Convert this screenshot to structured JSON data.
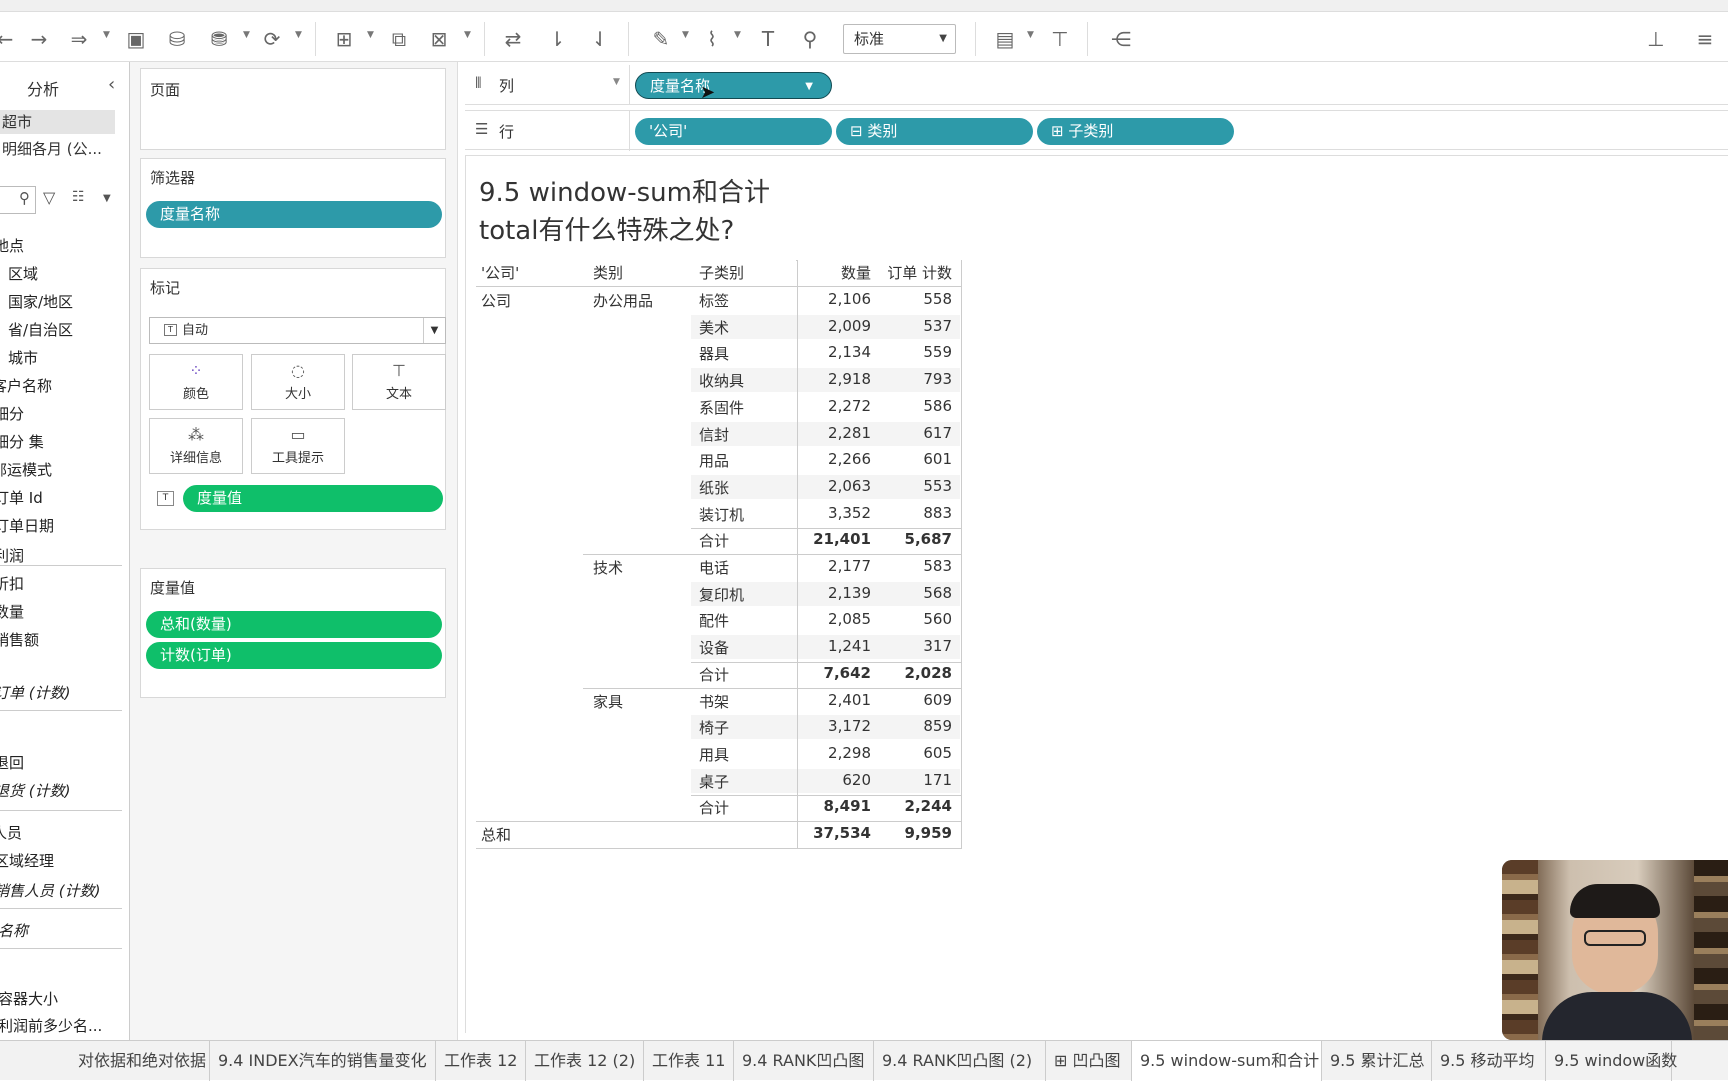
{
  "toolbar": {
    "standard_select": "标准"
  },
  "left_pane": {
    "tab_label": "分析",
    "datasources": [
      "超市",
      "明细各月 (公..."
    ],
    "fields_dimensions": [
      "地点",
      "区域",
      "国家/地区",
      "省/自治区",
      "城市",
      "客户名称",
      "细分",
      "细分 集",
      "邮运模式",
      "订单 Id",
      "订单日期"
    ],
    "fields_measures": [
      "利润",
      "折扣",
      "数量",
      "销售额",
      "订单 (计数)"
    ],
    "fields_return": [
      "退回",
      "退货 (计数)"
    ],
    "fields_people": [
      "人员",
      "区域经理",
      "销售人员 (计数)"
    ],
    "fields_names": [
      "名称"
    ],
    "fields_sets": [
      "容器大小",
      "利润前多少名..."
    ]
  },
  "cards": {
    "pages": "页面",
    "filters": "筛选器",
    "filter_pill": "度量名称",
    "marks": "标记",
    "mark_type": "自动",
    "mark_buttons": [
      "颜色",
      "大小",
      "文本",
      "详细信息",
      "工具提示"
    ],
    "mark_pill": "度量值",
    "measure_values": "度量值",
    "measure_pills": [
      "总和(数量)",
      "计数(订单)"
    ]
  },
  "shelves": {
    "columns_label": "列",
    "columns_pill": "度量名称",
    "rows_label": "行",
    "rows_pills": [
      "'公司'",
      "⊟ 类别",
      "⊞ 子类别"
    ]
  },
  "view": {
    "title_line1": "9.5 window-sum和合计",
    "title_line2": "total有什么特殊之处?",
    "headers": [
      "'公司'",
      "类别",
      "子类别",
      "数量",
      "订单 计数"
    ],
    "company": "公司",
    "groups": [
      {
        "category": "办公用品",
        "rows": [
          [
            "标签",
            "2,106",
            "558"
          ],
          [
            "美术",
            "2,009",
            "537"
          ],
          [
            "器具",
            "2,134",
            "559"
          ],
          [
            "收纳具",
            "2,918",
            "793"
          ],
          [
            "系固件",
            "2,272",
            "586"
          ],
          [
            "信封",
            "2,281",
            "617"
          ],
          [
            "用品",
            "2,266",
            "601"
          ],
          [
            "纸张",
            "2,063",
            "553"
          ],
          [
            "装订机",
            "3,352",
            "883"
          ]
        ],
        "total": [
          "合计",
          "21,401",
          "5,687"
        ]
      },
      {
        "category": "技术",
        "rows": [
          [
            "电话",
            "2,177",
            "583"
          ],
          [
            "复印机",
            "2,139",
            "568"
          ],
          [
            "配件",
            "2,085",
            "560"
          ],
          [
            "设备",
            "1,241",
            "317"
          ]
        ],
        "total": [
          "合计",
          "7,642",
          "2,028"
        ]
      },
      {
        "category": "家具",
        "rows": [
          [
            "书架",
            "2,401",
            "609"
          ],
          [
            "椅子",
            "3,172",
            "859"
          ],
          [
            "用具",
            "2,298",
            "605"
          ],
          [
            "桌子",
            "620",
            "171"
          ]
        ],
        "total": [
          "合计",
          "8,491",
          "2,244"
        ]
      }
    ],
    "grand_total": [
      "总和",
      "37,534",
      "9,959"
    ]
  },
  "sheet_tabs": [
    "对依据和绝对依据",
    "9.4 INDEX汽车的销售量变化",
    "工作表 12",
    "工作表 12 (2)",
    "工作表 11",
    "9.4 RANK凹凸图",
    "9.4 RANK凹凸图 (2)",
    "⊞ 凹凸图",
    "9.5 window-sum和合计",
    "9.5 累计汇总",
    "9.5 移动平均",
    "9.5 window函数"
  ],
  "active_tab": "9.5 window-sum和合计"
}
